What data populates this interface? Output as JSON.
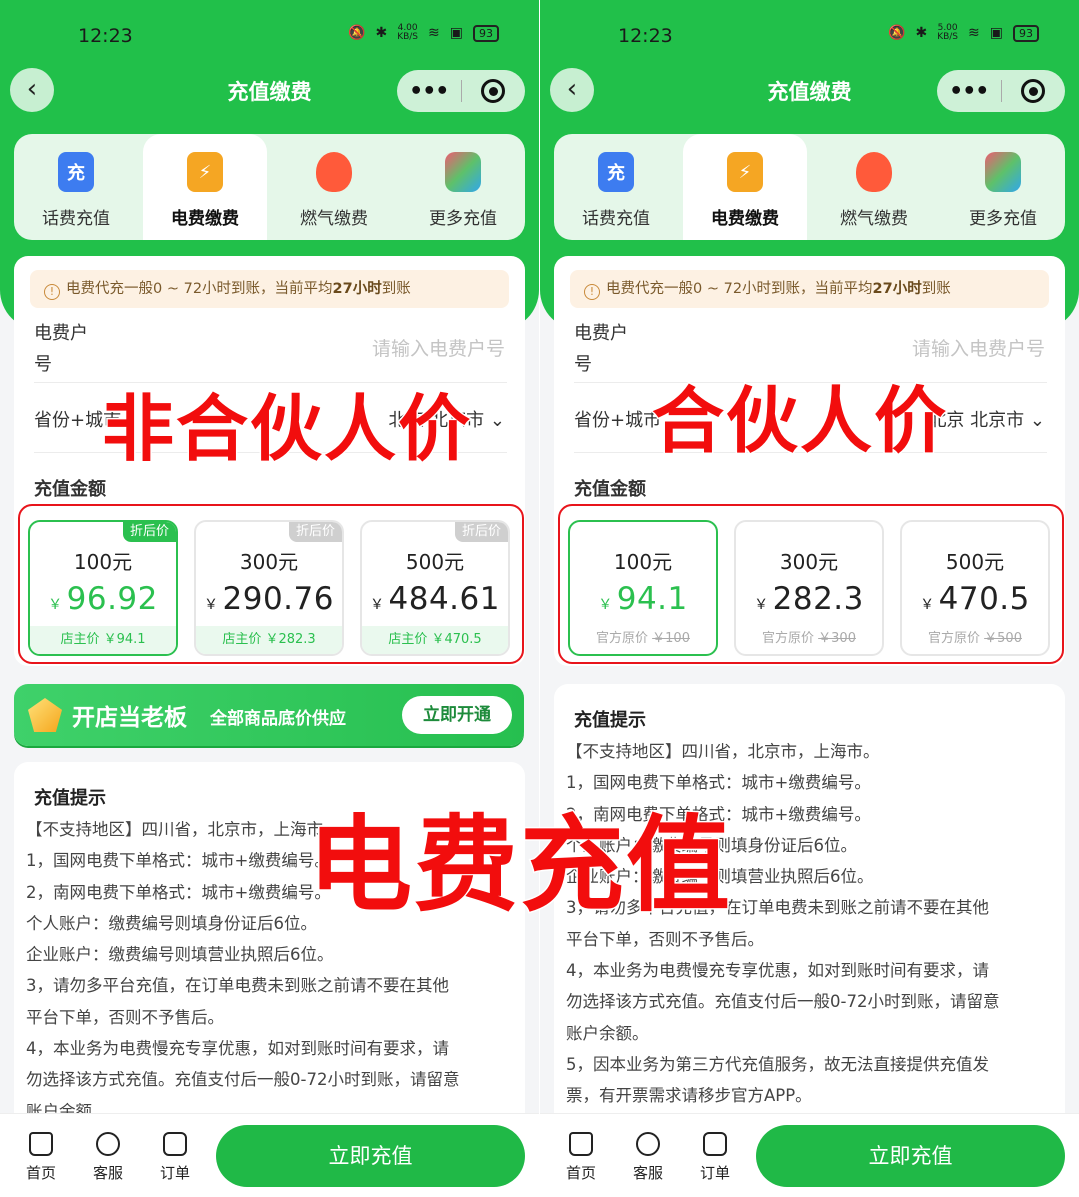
{
  "status_bar": {
    "time": "12:23",
    "battery": "93",
    "speed_left": "4.00",
    "speed_right": "5.00",
    "speed_unit": "KB/S"
  },
  "nav": {
    "title": "充值缴费",
    "more": "•••"
  },
  "categories": [
    "话费充值",
    "电费缴费",
    "燃气缴费",
    "更多充值"
  ],
  "category_icons": {
    "phone": "充",
    "elec": "⚡",
    "gas": "🔥",
    "more": "◎"
  },
  "notice": {
    "text_before": "电费代充一般0 ~ 72小时到账，当前平均",
    "highlight": "27小时",
    "text_after": "到账"
  },
  "form": {
    "account_label": "电费户号",
    "account_placeholder": "请输入电费户号",
    "city_label": "省份+城市",
    "city_value": "北京 北京市",
    "amount_label": "充值金额"
  },
  "left_options": [
    {
      "tag": "折后价",
      "face": "100元",
      "price": "96.92",
      "foot": "店主价 ￥94.1"
    },
    {
      "tag": "折后价",
      "face": "300元",
      "price": "290.76",
      "foot": "店主价 ￥282.3"
    },
    {
      "tag": "折后价",
      "face": "500元",
      "price": "484.61",
      "foot": "店主价 ￥470.5"
    }
  ],
  "right_options": [
    {
      "face": "100元",
      "price": "94.1",
      "foot_label": "官方原价",
      "foot_orig": "￥100"
    },
    {
      "face": "300元",
      "price": "282.3",
      "foot_label": "官方原价",
      "foot_orig": "￥300"
    },
    {
      "face": "500元",
      "price": "470.5",
      "foot_label": "官方原价",
      "foot_orig": "￥500"
    }
  ],
  "currency": "￥",
  "banner": {
    "title": "开店当老板",
    "subtitle": "全部商品底价供应",
    "button": "立即开通"
  },
  "tips": {
    "title": "充值提示",
    "lines": [
      "【不支持地区】四川省，北京市，上海市。",
      "1，国网电费下单格式：城市+缴费编号。",
      "2，南网电费下单格式：城市+缴费编号。",
      "个人账户：缴费编号则填身份证后6位。",
      "企业账户：缴费编号则填营业执照后6位。",
      "3，请勿多平台充值，在订单电费未到账之前请不要在其他",
      "平台下单，否则不予售后。",
      "4，本业务为电费慢充专享优惠，如对到账时间有要求，请",
      "勿选择该方式充值。充值支付后一般0-72小时到账，请留意",
      "账户余额。",
      "5，因本业务为第三方代充值服务，故无法直接提供充值发",
      "票，有开票需求请移步官方APP。"
    ]
  },
  "tabbar": {
    "home": "首页",
    "service": "客服",
    "orders": "订单",
    "pay": "立即充值"
  },
  "overlays": {
    "left": "非合伙人价",
    "right": "合伙人价",
    "center": "电费充值"
  }
}
